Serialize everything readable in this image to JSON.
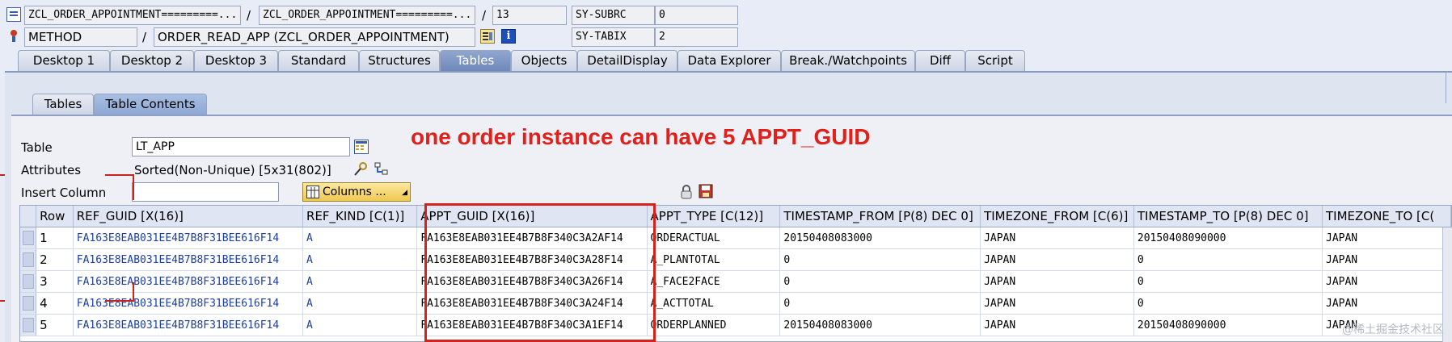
{
  "header": {
    "row1": {
      "field1": "ZCL_ORDER_APPOINTMENT=========...",
      "sep1": "/",
      "field2": "ZCL_ORDER_APPOINTMENT=========...",
      "sep2": "/",
      "line": "13",
      "var_name": "SY-SUBRC",
      "var_value": "0"
    },
    "row2": {
      "kind": "METHOD",
      "sep": "/",
      "method": "ORDER_READ_APP (ZCL_ORDER_APPOINTMENT)",
      "var_name": "SY-TABIX",
      "var_value": "2"
    }
  },
  "tabs": [
    "Desktop 1",
    "Desktop 2",
    "Desktop 3",
    "Standard",
    "Structures",
    "Tables",
    "Objects",
    "DetailDisplay",
    "Data Explorer",
    "Break./Watchpoints",
    "Diff",
    "Script"
  ],
  "active_tab": "Tables",
  "subtabs": [
    "Tables",
    "Table Contents"
  ],
  "active_subtab": "Table Contents",
  "form": {
    "table_label": "Table",
    "table_value": "LT_APP",
    "attributes_label": "Attributes",
    "attributes_value": "Sorted(Non-Unique) [5x31(802)]",
    "insert_column_label": "Insert Column",
    "insert_column_value": "",
    "columns_button": "Columns ..."
  },
  "annotation": "one order instance can have 5 APPT_GUID",
  "grid": {
    "columns": [
      "Row",
      "REF_GUID [X(16)]",
      "REF_KIND [C(1)]",
      "APPT_GUID [X(16)]",
      "APPT_TYPE [C(12)]",
      "TIMESTAMP_FROM [P(8) DEC 0]",
      "TIMEZONE_FROM [C(6)]",
      "TIMESTAMP_TO [P(8) DEC 0]",
      "TIMEZONE_TO [C("
    ],
    "rows": [
      [
        "1",
        "FA163E8EAB031EE4B7B8F31BEE616F14",
        "A",
        "FA163E8EAB031EE4B7B8F340C3A2AF14",
        "ORDERACTUAL",
        "20150408083000",
        "JAPAN",
        "20150408090000",
        "JAPAN"
      ],
      [
        "2",
        "FA163E8EAB031EE4B7B8F31BEE616F14",
        "A",
        "FA163E8EAB031EE4B7B8F340C3A28F14",
        "A_PLANTOTAL",
        "0",
        "JAPAN",
        "0",
        "JAPAN"
      ],
      [
        "3",
        "FA163E8EAB031EE4B7B8F31BEE616F14",
        "A",
        "FA163E8EAB031EE4B7B8F340C3A26F14",
        "A_FACE2FACE",
        "0",
        "JAPAN",
        "0",
        "JAPAN"
      ],
      [
        "4",
        "FA163E8EAB031EE4B7B8F31BEE616F14",
        "A",
        "FA163E8EAB031EE4B7B8F340C3A24F14",
        "A_ACTTOTAL",
        "0",
        "JAPAN",
        "0",
        "JAPAN"
      ],
      [
        "5",
        "FA163E8EAB031EE4B7B8F31BEE616F14",
        "A",
        "FA163E8EAB031EE4B7B8F340C3A1EF14",
        "ORDERPLANNED",
        "20150408083000",
        "JAPAN",
        "20150408090000",
        "JAPAN"
      ]
    ]
  },
  "watermark": "@稀土掘金技术社区",
  "colors": {
    "accent": "#6f89ba",
    "annotation": "#e0201a",
    "link": "#1b3ea3"
  }
}
